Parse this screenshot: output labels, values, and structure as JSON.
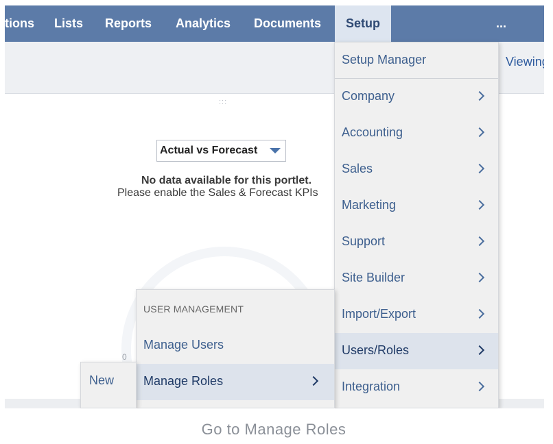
{
  "nav": {
    "items": [
      {
        "label": "tions"
      },
      {
        "label": "Lists"
      },
      {
        "label": "Reports"
      },
      {
        "label": "Analytics"
      },
      {
        "label": "Documents"
      },
      {
        "label": "Setup"
      }
    ],
    "more_label": "..."
  },
  "header": {
    "viewing_text": "Viewing"
  },
  "portlet": {
    "drag_handle": ":::",
    "select_value": "Actual vs Forecast",
    "nodata_title": "No data available for this portlet.",
    "nodata_message": "Please enable the Sales & Forecast KPIs",
    "axis_zero": "0"
  },
  "setup_menu": {
    "items": [
      {
        "label": "Setup Manager"
      },
      {
        "label": "Company"
      },
      {
        "label": "Accounting"
      },
      {
        "label": "Sales"
      },
      {
        "label": "Marketing"
      },
      {
        "label": "Support"
      },
      {
        "label": "Site Builder"
      },
      {
        "label": "Import/Export"
      },
      {
        "label": "Users/Roles"
      },
      {
        "label": "Integration"
      }
    ]
  },
  "user_management": {
    "header": "USER MANAGEMENT",
    "items": [
      {
        "label": "Manage Users"
      },
      {
        "label": "Manage Roles"
      }
    ]
  },
  "new_menu": {
    "label": "New"
  },
  "caption": "Go to Manage Roles",
  "colors": {
    "nav_bg": "#5c7ba8",
    "active_tab_bg": "#dde5f0",
    "menu_bg": "#f0f0f0",
    "menu_selected_bg": "#dde3ec",
    "link_blue": "#3d5f8e"
  }
}
